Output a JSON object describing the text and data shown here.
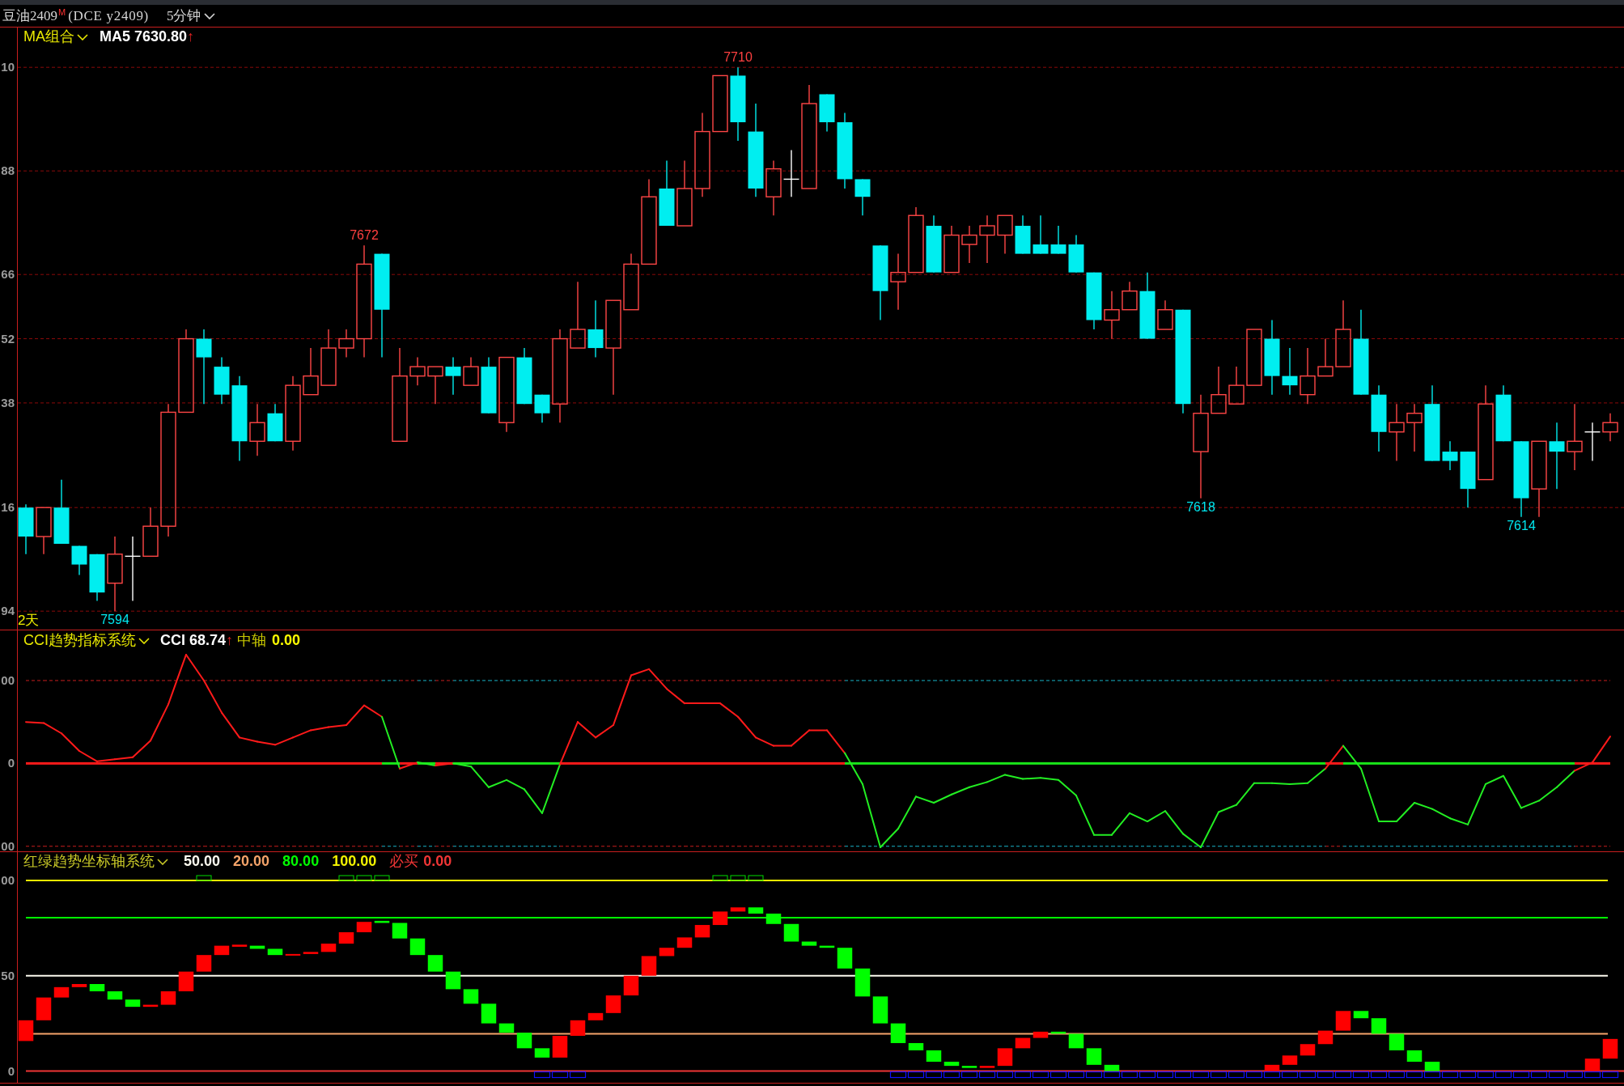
{
  "header": {
    "symbol": "豆油2409",
    "badge": "M",
    "code": "(DCE y2409)",
    "period": "5分钟"
  },
  "main_panel": {
    "indicator": "MA组合",
    "reading": "MA5 7630.80",
    "trend": "↑",
    "axis_labels": [
      "10",
      "88",
      "66",
      "52",
      "38",
      "16",
      "94"
    ],
    "price_marks": [
      {
        "kind": "high",
        "text": "7710"
      },
      {
        "kind": "high",
        "text": "7672"
      },
      {
        "kind": "low",
        "text": "7618"
      },
      {
        "kind": "low",
        "text": "7614"
      },
      {
        "kind": "low",
        "text": "7594"
      }
    ],
    "range_label": "2天"
  },
  "cci_panel": {
    "indicator": "CCI趋势指标系统",
    "reading": "CCI 68.74",
    "trend": "↑",
    "center_label": "中轴",
    "center_value": "0.00",
    "axis_labels": [
      "00",
      "0",
      "00"
    ]
  },
  "trend_panel": {
    "indicator": "红绿趋势坐标轴系统",
    "levels": [
      {
        "value": "50.00",
        "color": "#fdfbf0"
      },
      {
        "value": "20.00",
        "color": "#f5a46a"
      },
      {
        "value": "80.00",
        "color": "#00ff00"
      },
      {
        "value": "100.00",
        "color": "#f2f200"
      },
      {
        "label": "必买",
        "value": "0.00",
        "color": "#f03535"
      }
    ],
    "axis_labels": [
      "00",
      "50",
      "0"
    ]
  }
}
